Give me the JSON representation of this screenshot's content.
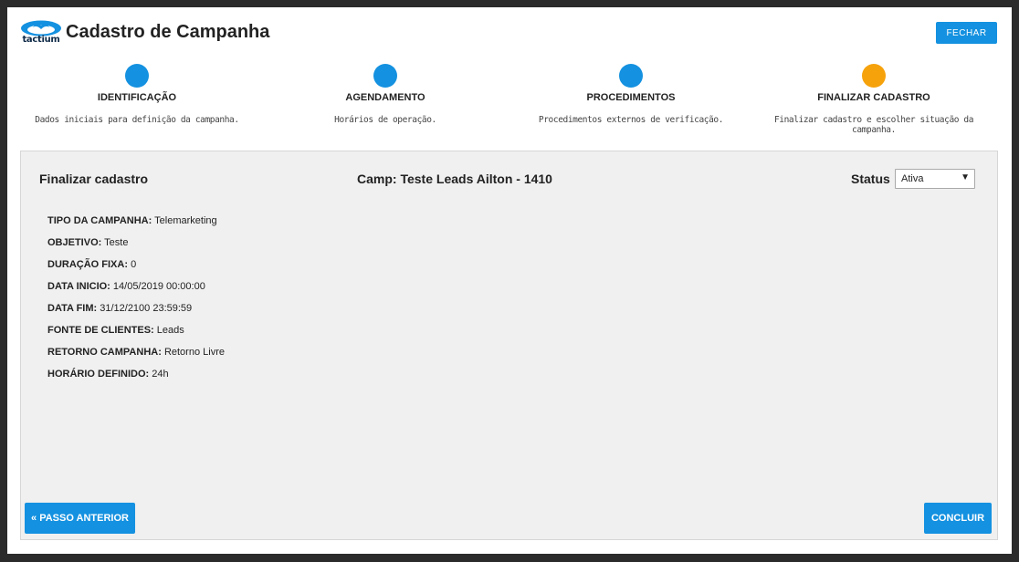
{
  "header": {
    "logo_text": "tactium",
    "title": "Cadastro de Campanha",
    "close_label": "FECHAR"
  },
  "steps": [
    {
      "title": "IDENTIFICAÇÃO",
      "description": "Dados iniciais para definição da campanha.",
      "state": "done"
    },
    {
      "title": "AGENDAMENTO",
      "description": "Horários de operação.",
      "state": "done"
    },
    {
      "title": "PROCEDIMENTOS",
      "description": "Procedimentos externos de verificação.",
      "state": "done"
    },
    {
      "title": "FINALIZAR CADASTRO",
      "description": "Finalizar cadastro e escolher situação da campanha.",
      "state": "active"
    }
  ],
  "panel": {
    "title": "Finalizar cadastro",
    "campaign": "Camp: Teste Leads Ailton - 1410",
    "status_label": "Status",
    "status_value": "Ativa"
  },
  "details": [
    {
      "label": "TIPO DA CAMPANHA:",
      "value": "Telemarketing"
    },
    {
      "label": "OBJETIVO:",
      "value": "Teste"
    },
    {
      "label": "DURAÇÃO FIXA:",
      "value": "0"
    },
    {
      "label": "DATA INICIO:",
      "value": "14/05/2019 00:00:00"
    },
    {
      "label": "DATA FIM:",
      "value": "31/12/2100 23:59:59"
    },
    {
      "label": "FONTE DE CLIENTES:",
      "value": "Leads"
    },
    {
      "label": "RETORNO CAMPANHA:",
      "value": "Retorno Livre"
    },
    {
      "label": "HORÁRIO DEFINIDO:",
      "value": "24h"
    }
  ],
  "footer": {
    "prev_label": "« PASSO ANTERIOR",
    "next_label": "CONCLUIR"
  },
  "colors": {
    "primary": "#1491e0",
    "active_step": "#f6a20b",
    "panel_bg": "#f0f0f0"
  }
}
